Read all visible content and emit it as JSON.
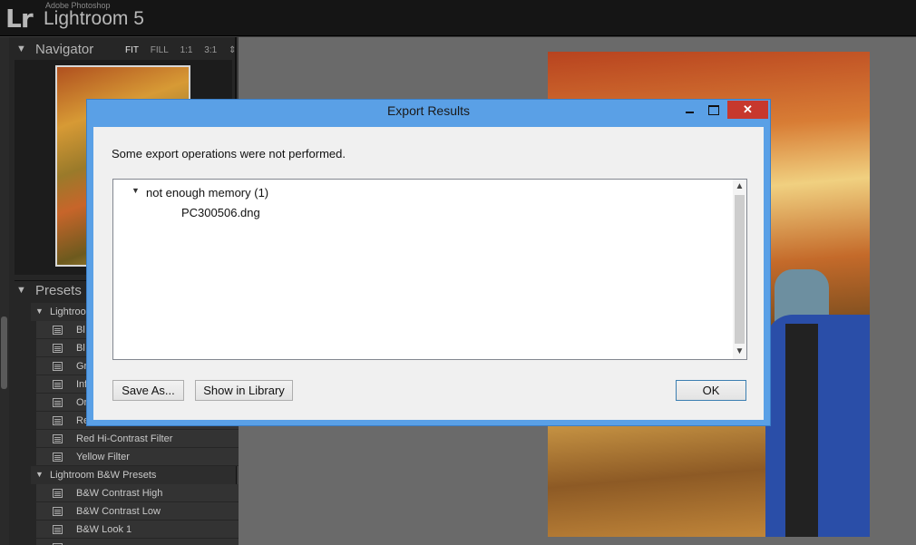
{
  "app": {
    "logo": "Lr",
    "vendor": "Adobe Photoshop",
    "name": "Lightroom 5"
  },
  "navigator": {
    "title": "Navigator",
    "zoom_options": [
      "FIT",
      "FILL",
      "1:1",
      "3:1"
    ],
    "active_zoom": "FIT"
  },
  "presets": {
    "title": "Presets",
    "groups": [
      {
        "label": "Lightroo"
      },
      {
        "label": "Lightroom B&W Presets"
      }
    ],
    "items": [
      {
        "label": "Bl"
      },
      {
        "label": "Bl"
      },
      {
        "label": "Gr"
      },
      {
        "label": "Inf"
      },
      {
        "label": "Or"
      },
      {
        "label": "Re"
      },
      {
        "label": "Red Hi-Contrast Filter"
      },
      {
        "label": "Yellow Filter"
      },
      {
        "label": "B&W Contrast High"
      },
      {
        "label": "B&W Contrast Low"
      },
      {
        "label": "B&W Look 1"
      }
    ]
  },
  "dialog": {
    "title": "Export Results",
    "message": "Some export operations were not performed.",
    "issue_label": "not enough memory (1)",
    "issue_file": "PC300506.dng",
    "close_glyph": "✕",
    "buttons": {
      "save_as": "Save As...",
      "show_in_library": "Show in Library",
      "ok": "OK"
    },
    "colors": {
      "frame": "#5aa0e6",
      "close": "#c7382d"
    }
  }
}
